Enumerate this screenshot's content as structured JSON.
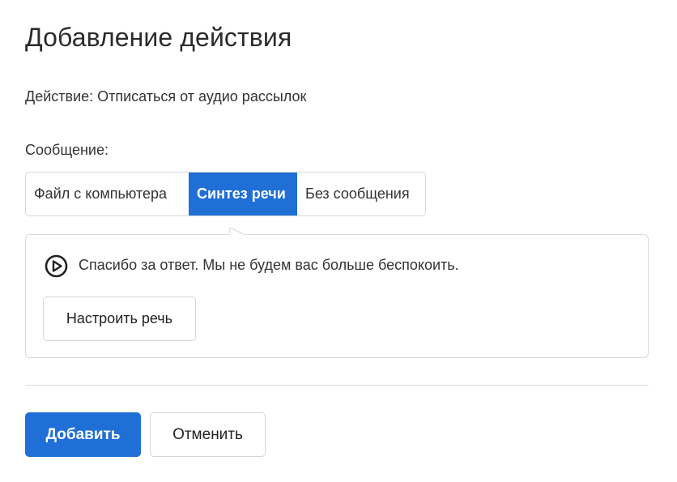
{
  "header": {
    "title": "Добавление действия"
  },
  "action": {
    "line": "Действие: Отписаться от аудио рассылок"
  },
  "message": {
    "label": "Сообщение:",
    "tabs": [
      {
        "label": "Файл с компьютера",
        "active": false
      },
      {
        "label": "Синтез речи",
        "active": true
      },
      {
        "label": "Без сообщения",
        "active": false
      }
    ]
  },
  "tts": {
    "play_icon": "play-circle-icon",
    "text": "Спасибо за ответ. Мы не будем вас больше беспокоить.",
    "configure_label": "Настроить речь"
  },
  "footer": {
    "add_label": "Добавить",
    "cancel_label": "Отменить"
  },
  "colors": {
    "accent": "#1f6fd6",
    "border": "#d6d6d6",
    "text": "#333333"
  }
}
